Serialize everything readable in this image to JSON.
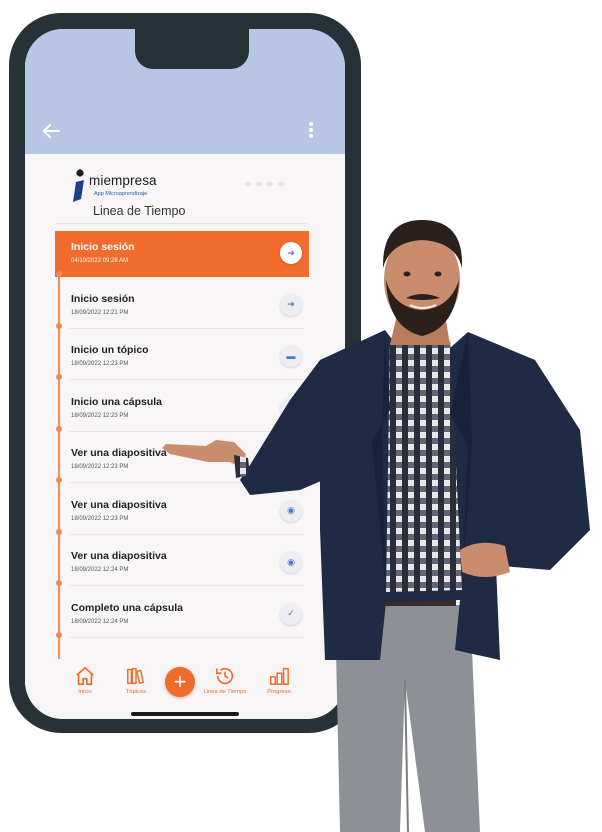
{
  "app": {
    "brand_name": "miempresa",
    "brand_sub": "App Microaprendizaje",
    "page_title": "Linea de Tiempo",
    "appbar_color": "#b7c6e4",
    "accent_color": "#f06b2c"
  },
  "appbar": {
    "back_icon": "arrow-left-icon",
    "menu_icon": "more-vertical-icon"
  },
  "timeline": [
    {
      "title": "Inicio sesión",
      "date": "04/10/2022 09:28 AM",
      "icon": "arrow-right-icon",
      "active": true
    },
    {
      "title": "Inicio sesión",
      "date": "18/09/2022 12:21 PM",
      "icon": "arrow-right-icon",
      "active": false
    },
    {
      "title": "Inicio un tópico",
      "date": "18/09/2022 12:23 PM",
      "icon": "minus-icon",
      "active": false
    },
    {
      "title": "Inicio una cápsula",
      "date": "18/09/2022 12:23 PM",
      "icon": "play-icon",
      "active": false
    },
    {
      "title": "Ver una diapositiva",
      "date": "18/09/2022 12:23 PM",
      "icon": "eye-icon",
      "active": false
    },
    {
      "title": "Ver una diapositiva",
      "date": "18/09/2022 12:23 PM",
      "icon": "eye-icon",
      "active": false
    },
    {
      "title": "Ver una diapositiva",
      "date": "18/09/2022 12:24 PM",
      "icon": "eye-icon",
      "active": false
    },
    {
      "title": "Completo una cápsula",
      "date": "18/09/2022 12:24 PM",
      "icon": "check-icon",
      "active": false
    }
  ],
  "bottom_nav": [
    {
      "label": "Inicio",
      "icon": "home-icon"
    },
    {
      "label": "Tópicos",
      "icon": "books-icon"
    },
    {
      "label": "Linea de Tiempo",
      "icon": "history-icon"
    },
    {
      "label": "Progreso",
      "icon": "bar-chart-icon"
    }
  ],
  "fab": {
    "icon": "plus-icon",
    "glyph": "+"
  }
}
